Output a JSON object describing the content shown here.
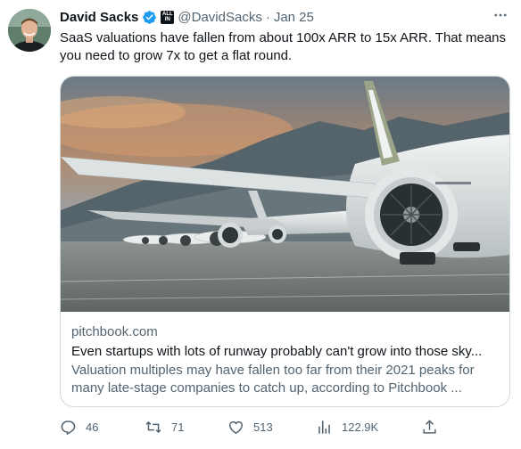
{
  "author": {
    "name": "David Sacks",
    "handle": "@DavidSacks",
    "separator": "·",
    "time": "Jan 25",
    "affiliate_badge": [
      "ALL",
      "IN"
    ]
  },
  "tweet_text": "SaaS valuations have fallen from about 100x ARR to 15x ARR. That means you need to grow 7x to get a flat round.",
  "card": {
    "domain": "pitchbook.com",
    "title": "Even startups with lots of runway probably can't grow into those sky...",
    "description": "Valuation multiples may have fallen too far from their 2021 peaks for many late-stage companies to catch up, according to Pitchbook ..."
  },
  "actions": {
    "replies": "46",
    "retweets": "71",
    "likes": "513",
    "views": "122.9K"
  },
  "colors": {
    "verified": "#1d9bf0",
    "secondary_text": "#536471",
    "primary_text": "#0f1419",
    "border": "#cfd9de"
  },
  "icons": [
    "more-icon",
    "verified-badge-icon",
    "affiliate-badge-icon",
    "reply-icon",
    "retweet-icon",
    "like-icon",
    "views-icon",
    "share-icon"
  ]
}
